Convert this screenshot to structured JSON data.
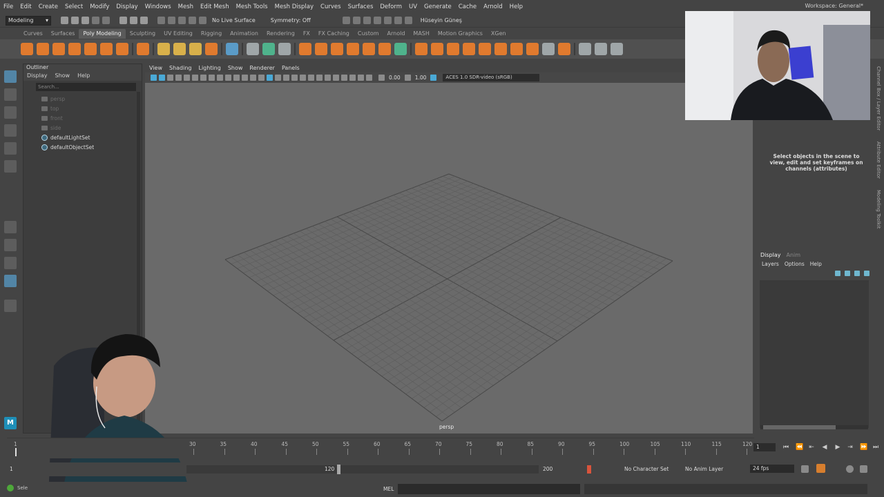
{
  "menubar": {
    "items": [
      "File",
      "Edit",
      "Create",
      "Select",
      "Modify",
      "Display",
      "Windows",
      "Mesh",
      "Edit Mesh",
      "Mesh Tools",
      "Mesh Display",
      "Curves",
      "Surfaces",
      "Deform",
      "UV",
      "Generate",
      "Cache",
      "Arnold",
      "Help"
    ],
    "workspace": "Workspace: General*"
  },
  "statusline": {
    "mode": "Modeling",
    "live_surface": "No Live Surface",
    "symmetry": "Symmetry: Off",
    "user": "Hüseyin Güneş"
  },
  "shelf": {
    "tabs": [
      "Curves",
      "Surfaces",
      "Poly Modeling",
      "Sculpting",
      "UV Editing",
      "Rigging",
      "Animation",
      "Rendering",
      "FX",
      "FX Caching",
      "Custom",
      "Arnold",
      "MASH",
      "Motion Graphics",
      "XGen"
    ],
    "active_tab": "Poly Modeling"
  },
  "outliner": {
    "title": "Outliner",
    "menu": [
      "Display",
      "Show",
      "Help"
    ],
    "search_placeholder": "Search...",
    "items": [
      {
        "label": "persp",
        "type": "camera"
      },
      {
        "label": "top",
        "type": "camera"
      },
      {
        "label": "front",
        "type": "camera"
      },
      {
        "label": "side",
        "type": "camera"
      },
      {
        "label": "defaultLightSet",
        "type": "set"
      },
      {
        "label": "defaultObjectSet",
        "type": "set"
      }
    ]
  },
  "viewport": {
    "menu": [
      "View",
      "Shading",
      "Lighting",
      "Show",
      "Renderer",
      "Panels"
    ],
    "exposure": "0.00",
    "gamma": "1.00",
    "color_space": "ACES 1.0 SDR-video (sRGB)",
    "camera": "persp"
  },
  "channelbox": {
    "message": "Select objects in the scene to view, edit and set keyframes on channels (attributes)",
    "side_tabs": [
      "Channel Box / Layer Editor",
      "Attribute Editor",
      "Modeling Toolkit"
    ]
  },
  "layers": {
    "tabs": [
      "Display",
      "Anim"
    ],
    "menu": [
      "Layers",
      "Options",
      "Help"
    ]
  },
  "timeslider": {
    "start_label": "1",
    "ticks": [
      "30",
      "35",
      "40",
      "45",
      "50",
      "55",
      "60",
      "65",
      "70",
      "75",
      "80",
      "85",
      "90",
      "95",
      "100",
      "105",
      "110",
      "115",
      "120"
    ],
    "current_frame": "1"
  },
  "rangeslider": {
    "start": "1",
    "range_end": "120",
    "end": "200",
    "character_set": "No Character Set",
    "anim_layer": "No Anim Layer",
    "fps": "24 fps"
  },
  "cmdline": {
    "mel": "MEL",
    "help_text": "Sele"
  },
  "colors": {
    "accent_blue": "#4aa9d6",
    "shelf_orange": "#e07a2e",
    "viewport_bg": "#6a6a6a"
  }
}
